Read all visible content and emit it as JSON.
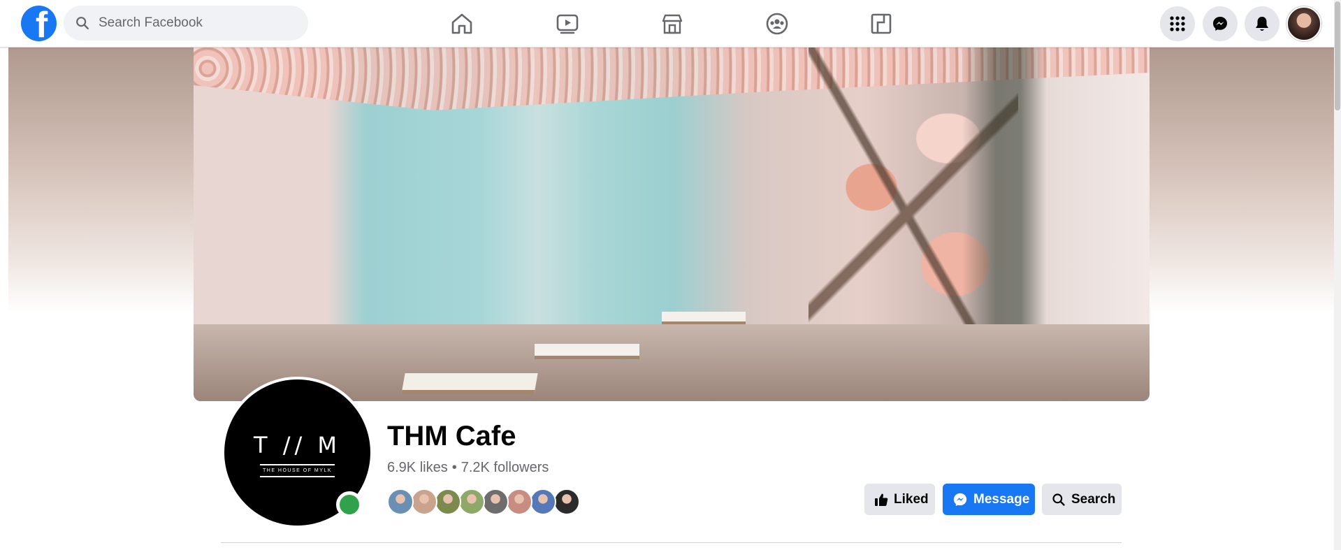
{
  "topbar": {
    "search_placeholder": "Search Facebook",
    "nav": [
      "home-icon",
      "watch-icon",
      "marketplace-icon",
      "groups-icon",
      "gaming-icon"
    ],
    "right": [
      "menu-grid-icon",
      "messenger-icon",
      "notifications-icon",
      "account-avatar"
    ]
  },
  "page": {
    "name": "THM Cafe",
    "likes": "6.9K likes",
    "separator": "•",
    "followers": "7.2K followers",
    "logo_text": "T // M",
    "logo_subtext": "THE HOUSE OF MYLK",
    "online": true
  },
  "friends_who_like": [
    {
      "color": "#6a8fb5"
    },
    {
      "color": "#c9a38c"
    },
    {
      "color": "#7c8a4e"
    },
    {
      "color": "#8ea86a"
    },
    {
      "color": "#6d6d6d"
    },
    {
      "color": "#c78d83"
    },
    {
      "color": "#5478b8"
    },
    {
      "color": "#2b2b2b"
    }
  ],
  "actions": {
    "liked": "Liked",
    "message": "Message",
    "search": "Search"
  },
  "colors": {
    "brand": "#1877f2",
    "online": "#31a24c",
    "button_gray": "#e4e6eb"
  }
}
